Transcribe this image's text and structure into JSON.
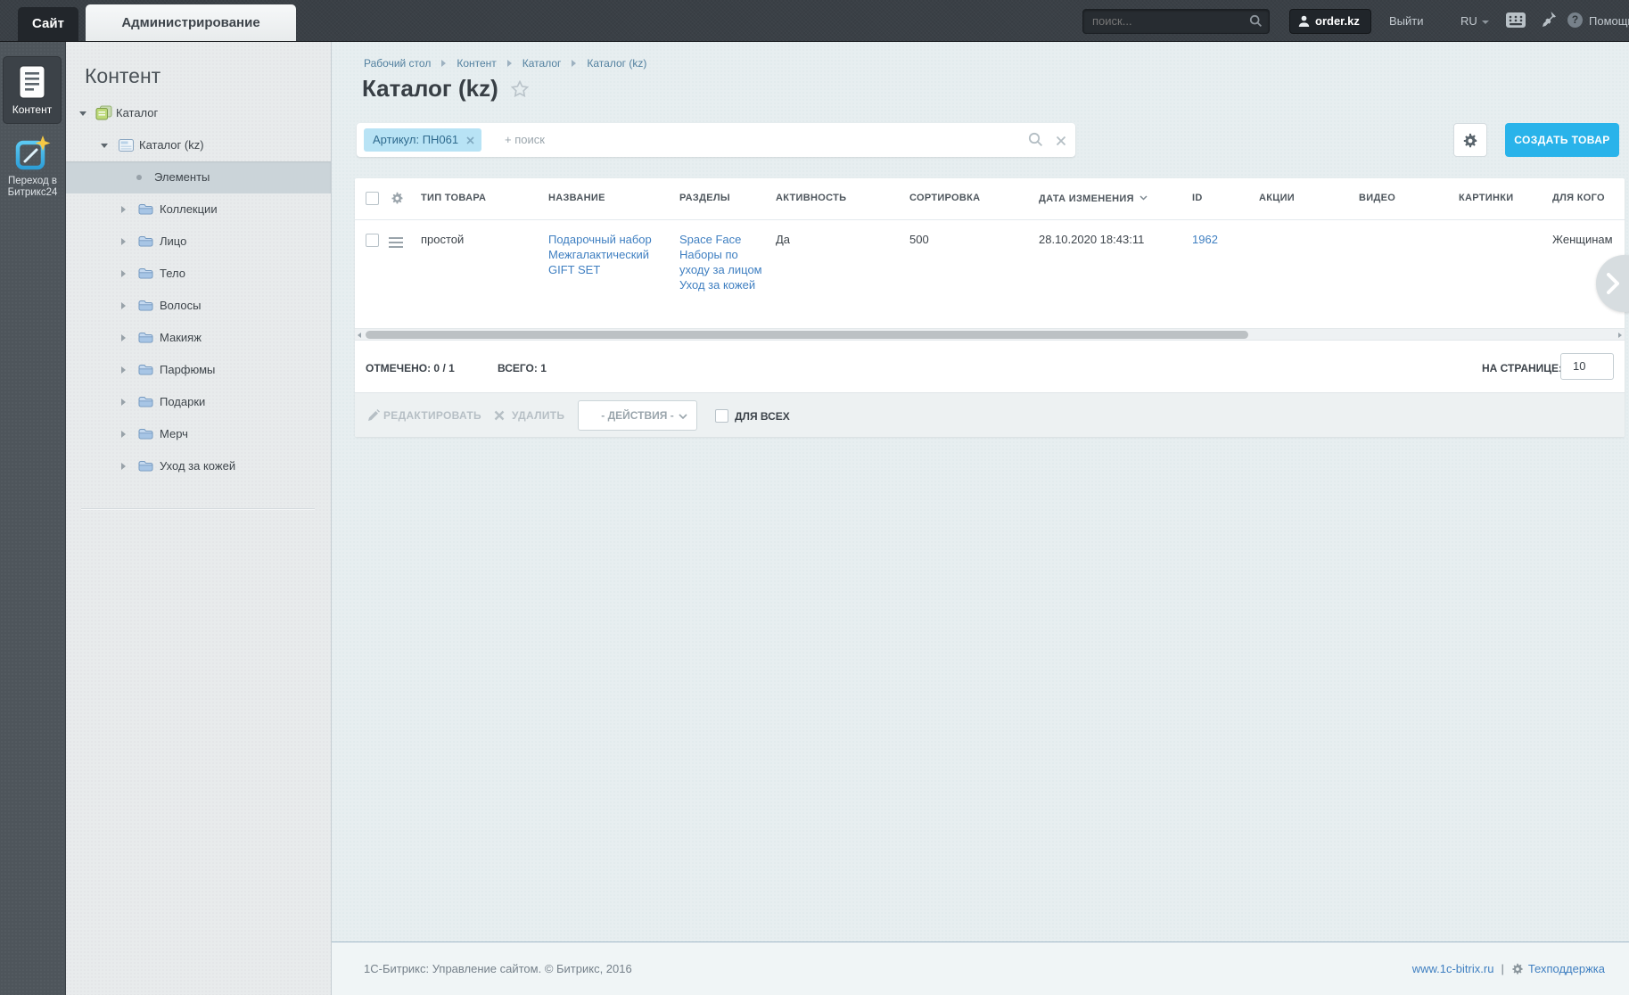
{
  "topbar": {
    "tab_site": "Сайт",
    "tab_admin": "Администрирование",
    "search_placeholder": "поиск...",
    "user": "order.kz",
    "logout": "Выйти",
    "lang": "RU",
    "help_glyph": "?",
    "help": "Помощь"
  },
  "rail": {
    "content": "Контент",
    "b24_line1": "Переход в",
    "b24_line2": "Битрикс24"
  },
  "sidebar": {
    "title": "Контент",
    "tree": [
      {
        "label": "Каталог"
      },
      {
        "label": "Каталог (kz)"
      },
      {
        "label": "Элементы"
      },
      {
        "label": "Коллекции"
      },
      {
        "label": "Лицо"
      },
      {
        "label": "Тело"
      },
      {
        "label": "Волосы"
      },
      {
        "label": "Макияж"
      },
      {
        "label": "Парфюмы"
      },
      {
        "label": "Подарки"
      },
      {
        "label": "Мерч"
      },
      {
        "label": "Уход за кожей"
      }
    ]
  },
  "breadcrumb": {
    "items": [
      {
        "label": "Рабочий стол"
      },
      {
        "label": "Контент"
      },
      {
        "label": "Каталог"
      },
      {
        "label": "Каталог (kz)"
      }
    ]
  },
  "page": {
    "title": "Каталог (kz)"
  },
  "filter": {
    "chip": "Артикул: ПН061",
    "add_label": "+ поиск"
  },
  "toolbar": {
    "create_label": "СОЗДАТЬ ТОВАР"
  },
  "table": {
    "columns": [
      {
        "label": "ТИП ТОВАРА"
      },
      {
        "label": "НАЗВАНИЕ"
      },
      {
        "label": "РАЗДЕЛЫ"
      },
      {
        "label": "АКТИВНОСТЬ"
      },
      {
        "label": "СОРТИРОВКА"
      },
      {
        "label": "ДАТА ИЗМЕНЕНИЯ"
      },
      {
        "label": "ID"
      },
      {
        "label": "АКЦИИ"
      },
      {
        "label": "ВИДЕО"
      },
      {
        "label": "КАРТИНКИ"
      },
      {
        "label": "ДЛЯ КОГО"
      }
    ],
    "row": {
      "type": "простой",
      "name": "Подарочный набор Межгалактический GIFT SET",
      "sections": [
        "Space Face",
        "Наборы по уходу за лицом",
        "Уход за кожей"
      ],
      "active": "Да",
      "sort": "500",
      "modified": "28.10.2020 18:43:11",
      "id": "1962",
      "audience": "Женщинам"
    }
  },
  "grid_footer": {
    "checked_label": "ОТМЕЧЕНО: 0 / 1",
    "total_label": "ВСЕГО: 1",
    "per_page_label": "НА СТРАНИЦЕ:",
    "per_page_value": "10"
  },
  "action_bar": {
    "edit": "РЕДАКТИРОВАТЬ",
    "delete": "УДАЛИТЬ",
    "actions": "- ДЕЙСТВИЯ -",
    "for_all": "для всех"
  },
  "footer": {
    "copyright": "1С-Битрикс: Управление сайтом. © Битрикс, 2016",
    "site": "www.1c-bitrix.ru",
    "divider": "|",
    "support": "Техподдержка"
  },
  "colors": {
    "accent": "#29b3ea",
    "link": "#3f7fc1",
    "topbar_bg": "#3a4046",
    "chip_bg": "#b8e3f5"
  }
}
